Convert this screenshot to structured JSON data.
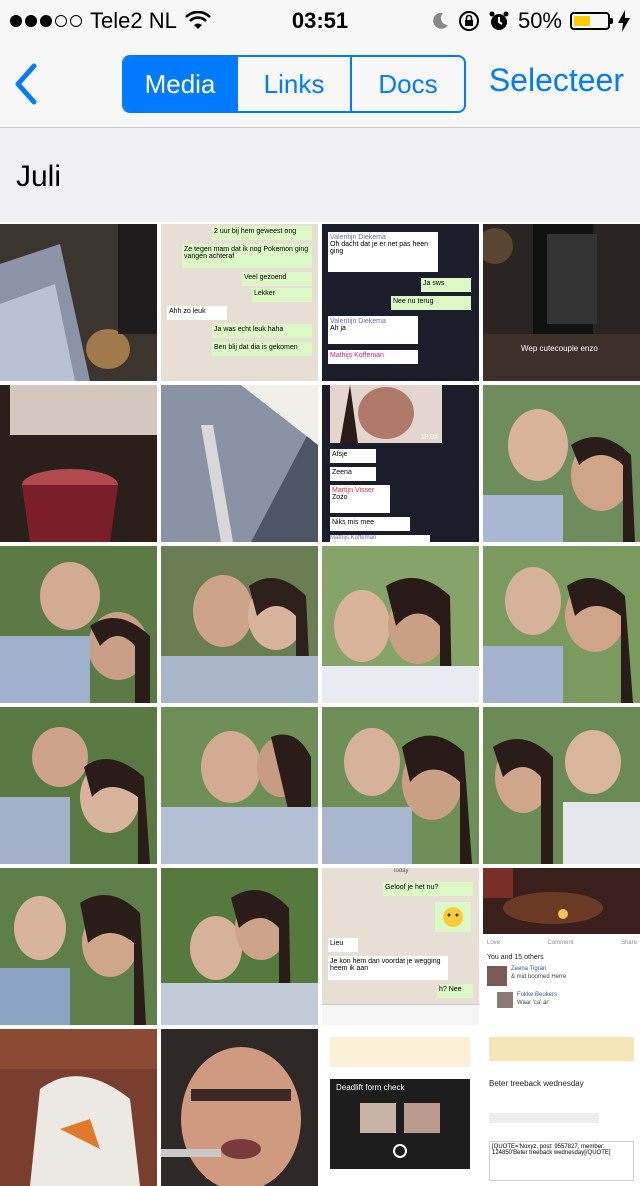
{
  "status_bar": {
    "carrier": "Tele2 NL",
    "time": "03:51",
    "battery_percent": "50%",
    "battery_level": 0.5,
    "signal_bars": 3
  },
  "nav": {
    "back_icon": "chevron-left-icon",
    "segments": [
      "Media",
      "Links",
      "Docs"
    ],
    "active_segment": "Media",
    "select_label": "Selecteer"
  },
  "section": {
    "title": "Juli"
  },
  "media": {
    "chat1": {
      "lines": [
        "2 uur bij hem geweest ong",
        "Ze tegen mam dat ik nog Pokemon ging vangen achteraf",
        "Veel gezoend",
        "Lekker",
        "Ahh zo leuk",
        "Ja was echt leuk haha",
        "Ben blij dat dia is gekomen"
      ]
    },
    "chat2": {
      "lines": [
        "Valentijn Diekema",
        "Oh dacht dat je er net pas heen ging",
        "Ja sws",
        "Nee nu terug",
        "Valentijn Diekema",
        "Ah ja",
        "Mathijs Koffeman"
      ]
    },
    "photo4_caption": "Wep cutecouple enzo",
    "chat3": {
      "lines": [
        "Afsje",
        "Zeena",
        "Martijn Visser",
        "Zozo",
        "Niks mis mee",
        "Mathijs Koffeman"
      ],
      "time": "18:04"
    },
    "chat4": {
      "lines": [
        "Today",
        "Geloof je het nu?",
        "Lieu",
        "Je kon hem dan voordat je wegging heem ik aan",
        "h? Nee"
      ]
    },
    "social": {
      "actions": [
        "Love",
        "Comment",
        "Share"
      ],
      "reactions": "You and 15 others",
      "commenter1": "Zeena Tigran",
      "comment1": "& mid boomed Herre",
      "commenter2": "Fokke Beukers",
      "comment2": "Waar 'ca' ar'"
    },
    "forum": {
      "line1": "Beter treeback wednesday",
      "line2": "Deadlift form check",
      "line3": "[QUOTE='Noxyz, post: 9557827, member: 124850'Beter treeback wednesday[/QUOTE]"
    }
  }
}
